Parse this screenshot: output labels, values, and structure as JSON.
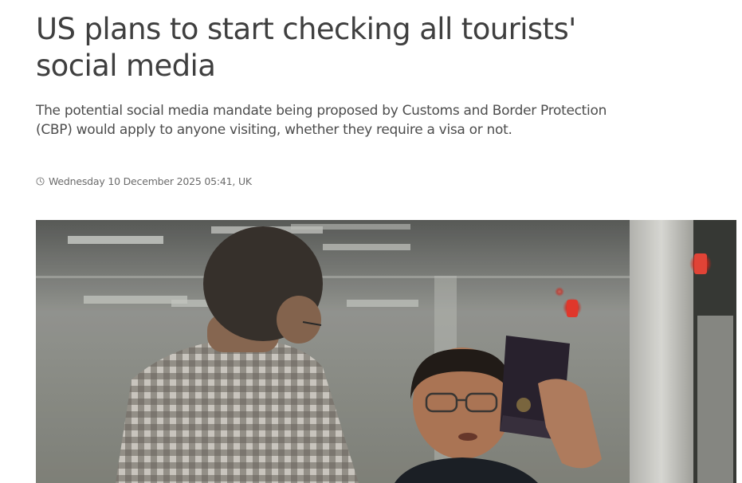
{
  "article": {
    "headline": "US plans to start checking all tourists' social media",
    "standfirst": "The potential social media mandate being proposed by Customs and Border Protection (CBP) would apply to anyone visiting, whether they require a visa or not.",
    "dateline": "Wednesday 10 December 2025 05:41, UK",
    "dateline_icon": "clock-icon"
  },
  "hero_image": {
    "description_icon": "photo"
  },
  "colors": {
    "text": "#3f3f3f",
    "meta": "#6b6b6b",
    "background": "#ffffff"
  }
}
